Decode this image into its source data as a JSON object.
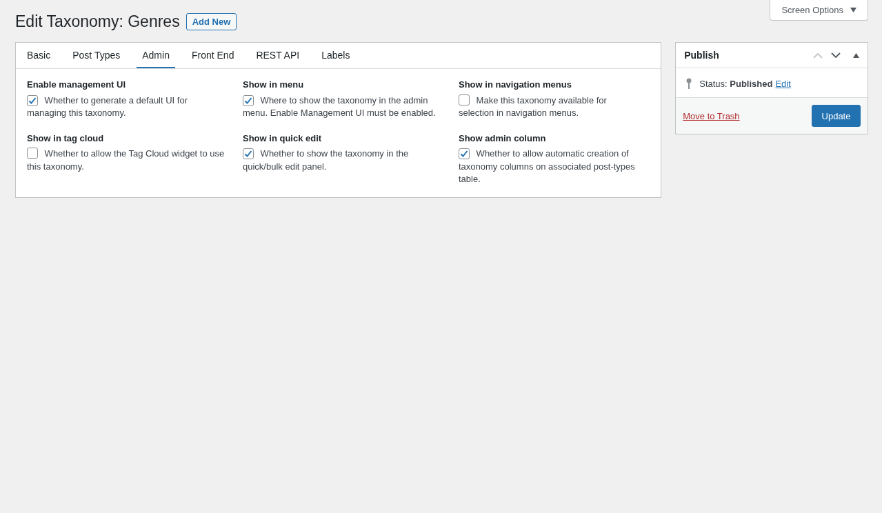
{
  "screen_options": {
    "label": "Screen Options"
  },
  "page_title": "Edit Taxonomy: Genres",
  "add_new_button": "Add New",
  "tabs": [
    {
      "label": "Basic",
      "selected": false
    },
    {
      "label": "Post Types",
      "selected": false
    },
    {
      "label": "Admin",
      "selected": true
    },
    {
      "label": "Front End",
      "selected": false
    },
    {
      "label": "REST API",
      "selected": false
    },
    {
      "label": "Labels",
      "selected": false
    }
  ],
  "settings": [
    {
      "title": "Enable management UI",
      "description": "Whether to generate a default UI for managing this taxonomy.",
      "checked": true
    },
    {
      "title": "Show in menu",
      "description": "Where to show the taxonomy in the admin menu. Enable Management UI must be enabled.",
      "checked": true
    },
    {
      "title": "Show in navigation menus",
      "description": "Make this taxonomy available for selection in navigation menus.",
      "checked": false
    },
    {
      "title": "Show in tag cloud",
      "description": "Whether to allow the Tag Cloud widget to use this taxonomy.",
      "checked": false
    },
    {
      "title": "Show in quick edit",
      "description": "Whether to show the taxonomy in the quick/bulk edit panel.",
      "checked": true
    },
    {
      "title": "Show admin column",
      "description": "Whether to allow automatic creation of taxonomy columns on associated post-types table.",
      "checked": true
    }
  ],
  "publish": {
    "title": "Publish",
    "move_up_disabled": true,
    "status": "Status: **Published**",
    "edit_link": "Edit",
    "trash_link": "Move to Trash",
    "update_button": "Update"
  }
}
